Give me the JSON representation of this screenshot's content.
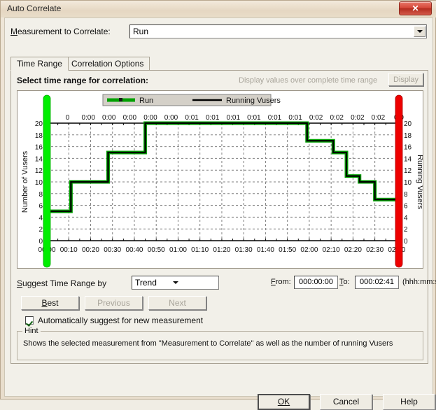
{
  "window": {
    "title": "Auto Correlate",
    "close_label": "✕"
  },
  "measurement": {
    "label_pre": "M",
    "label_post": "easurement to Correlate:",
    "value": "Run"
  },
  "tabs": [
    {
      "label": "Time Range",
      "active": true
    },
    {
      "label": "Correlation Options",
      "active": false
    }
  ],
  "panel": {
    "select_label": "Select time range for correlation:",
    "display_hint": "Display values over complete time range",
    "display_button": "Display"
  },
  "suggest": {
    "label_pre": "S",
    "label_post": "uggest Time Range by",
    "trend_value": "Trend",
    "from_label_pre": "F",
    "from_label_post": "rom:",
    "from_value": "000:00:00",
    "to_label_pre": "T",
    "to_label_post": "o:",
    "to_value": "000:02:41",
    "format_label": "(hhh:mm:ss)",
    "best": "Best",
    "best_pre": "B",
    "best_post": "est",
    "previous": "Previous",
    "next": "Next",
    "auto_checkbox": "Automatically suggest for new measurement"
  },
  "hint": {
    "legend": "Hint",
    "text": "Shows the selected measurement from \"Measurement to Correlate\" as well as the number of running Vusers"
  },
  "buttons": {
    "ok": "OK",
    "cancel": "Cancel",
    "help": "Help"
  },
  "colors": {
    "series_run": "#00a000",
    "series_vusers": "#000000",
    "marker_start": "#00ee00",
    "marker_end": "#ee0000",
    "close_button": "#c0392b"
  },
  "chart_data": {
    "type": "line",
    "title": "",
    "xlabel": "",
    "ylabel": "Number of Vusers",
    "y2label": "Running Vusers",
    "legend": [
      {
        "name": "Run",
        "color": "#00a000",
        "marker": true
      },
      {
        "name": "Running Vusers",
        "color": "#000000",
        "marker": false
      }
    ],
    "legend_position": "top-center",
    "grid": true,
    "ylim": [
      0,
      20
    ],
    "y_ticks": [
      0,
      2,
      4,
      6,
      8,
      10,
      12,
      14,
      16,
      18,
      20
    ],
    "y2_ticks": [
      0,
      2,
      4,
      6,
      8,
      10,
      12,
      14,
      16,
      18,
      20
    ],
    "x_ticks_bottom": [
      "00:00",
      "00:10",
      "00:20",
      "00:30",
      "00:40",
      "00:50",
      "01:00",
      "01:10",
      "01:20",
      "01:30",
      "01:40",
      "01:50",
      "02:00",
      "02:10",
      "02:20",
      "02:30",
      "02:40"
    ],
    "x_ticks_top": [
      "0",
      "0",
      "0:00",
      "0:00",
      "0:00",
      "0:00",
      "0:00",
      "0:01",
      "0:01",
      "0:01",
      "0:01",
      "0:01",
      "0:01",
      "0:02",
      "0:02",
      "0:02",
      "0:02",
      "0:0"
    ],
    "xlim_seconds": [
      0,
      161
    ],
    "series": [
      {
        "name": "Run",
        "step": "post",
        "x": [
          0,
          11,
          28,
          45,
          113,
          119,
          131,
          137,
          143,
          150,
          161
        ],
        "y": [
          5,
          10,
          15,
          20,
          20,
          17,
          15,
          11,
          10,
          7,
          6
        ]
      },
      {
        "name": "Running Vusers",
        "step": "post",
        "x": [
          0,
          11,
          28,
          45,
          113,
          119,
          131,
          137,
          143,
          150,
          161
        ],
        "y": [
          5,
          10,
          15,
          20,
          20,
          17,
          15,
          11,
          10,
          7,
          6
        ]
      }
    ],
    "markers": [
      {
        "name": "range-start",
        "x_seconds": 0,
        "color": "#00ee00"
      },
      {
        "name": "range-end",
        "x_seconds": 161,
        "color": "#ee0000"
      }
    ]
  }
}
